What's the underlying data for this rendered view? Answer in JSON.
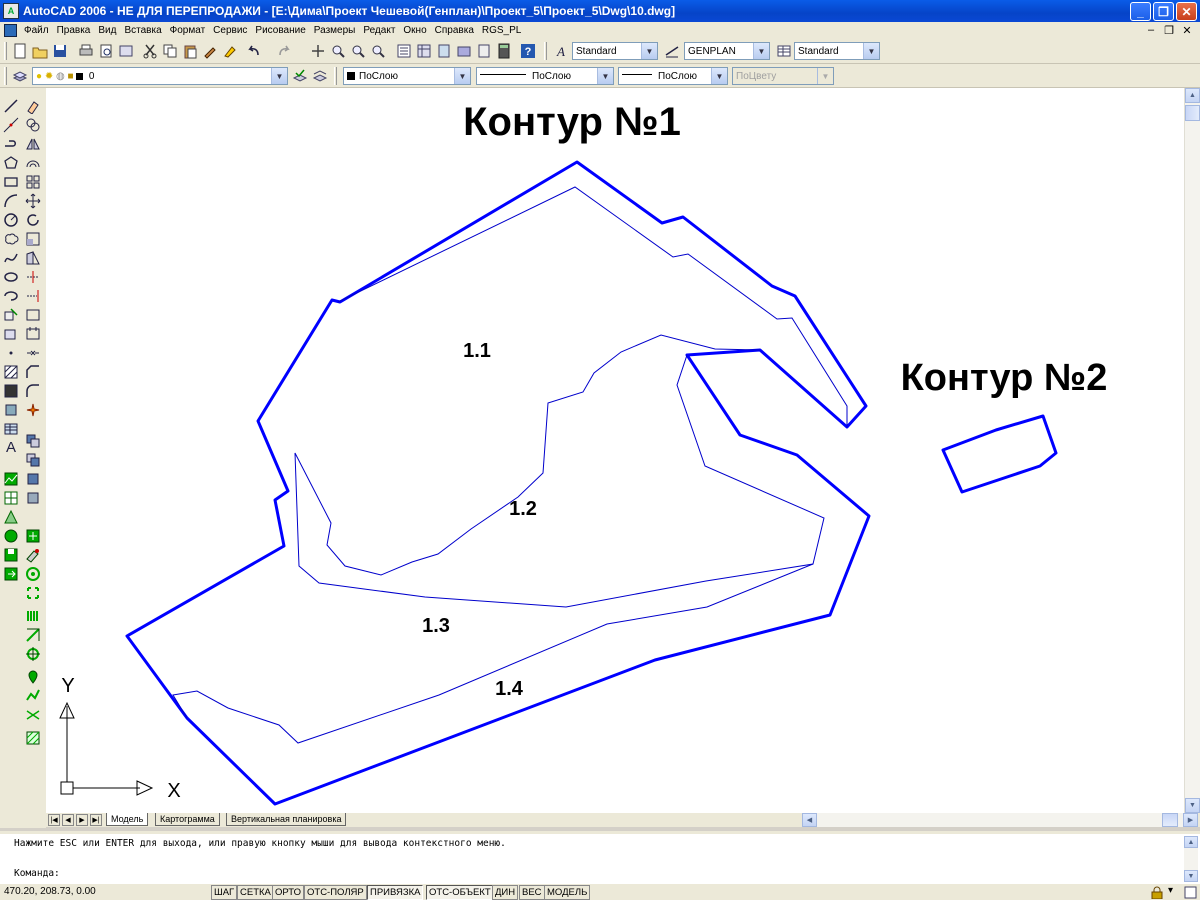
{
  "window": {
    "title": "AutoCAD 2006 - НЕ ДЛЯ ПЕРЕПРОДАЖИ - [E:\\Дима\\Проект Чешевой(Генплан)\\Проект_5\\Проект_5\\Dwg\\10.dwg]",
    "app_icon_label": "A"
  },
  "menu": {
    "items": [
      "Файл",
      "Правка",
      "Вид",
      "Вставка",
      "Формат",
      "Сервис",
      "Рисование",
      "Размеры",
      "Редакт",
      "Окно",
      "Справка",
      "RGS_PL"
    ]
  },
  "toolbar": {
    "text_style": "Standard",
    "dim_style": "GENPLAN",
    "table_style": "Standard",
    "layer": "0",
    "color": "ПоСлою",
    "linetype": "ПоСлою",
    "lineweight": "ПоСлою",
    "plotstyle": "ПоЦвету"
  },
  "drawing": {
    "labels": {
      "contour1": "Контур №1",
      "contour2": "Контур №2",
      "zone_1_1": "1.1",
      "zone_1_2": "1.2",
      "zone_1_3": "1.3",
      "zone_1_4": "1.4",
      "ucs_x": "X",
      "ucs_y": "Y"
    },
    "colors": {
      "outline": "#0000ff",
      "inner_line": "#0000cc",
      "background": "#ffffff"
    }
  },
  "tabs": [
    "Модель",
    "Картограмма",
    "Вертикальная планировка"
  ],
  "command": {
    "history": "Нажмите ESC или ENTER для выхода, или правую кнопку мыши для вывода контекстного меню.",
    "prompt": "Команда:"
  },
  "status": {
    "coordinates": "470.20, 208.73, 0.00",
    "buttons": [
      "ШАГ",
      "СЕТКА",
      "ОРТО",
      "ОТС-ПОЛЯР",
      "ПРИВЯЗКА",
      "ОТС-ОБЪЕКТ",
      "ДИН",
      "ВЕС",
      "МОДЕЛЬ"
    ]
  }
}
